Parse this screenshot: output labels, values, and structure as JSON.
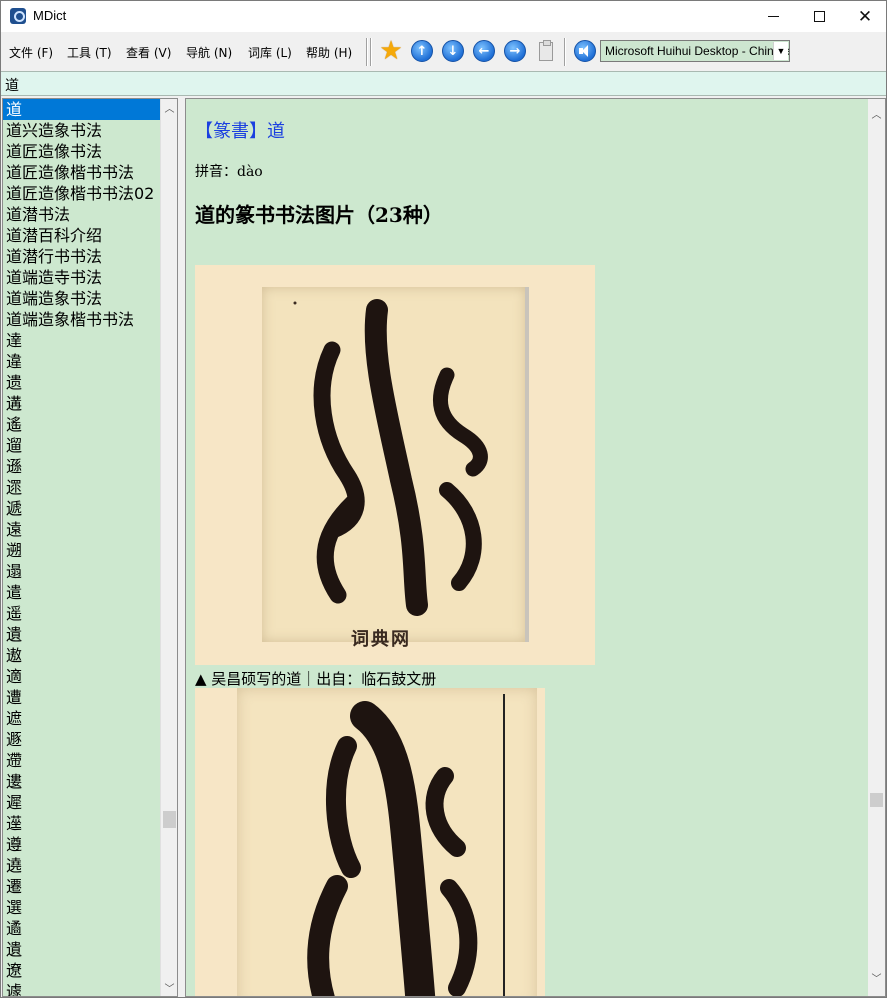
{
  "window": {
    "title": "MDict",
    "controls": [
      "minimize",
      "maximize",
      "close"
    ]
  },
  "menu": [
    {
      "label": "文件 (F)",
      "name": "menu-file"
    },
    {
      "label": "工具 (T)",
      "name": "menu-tools"
    },
    {
      "label": "查看 (V)",
      "name": "menu-view"
    },
    {
      "label": "导航 (N)",
      "name": "menu-navigate"
    },
    {
      "label": "词库 (L)",
      "name": "menu-library"
    },
    {
      "label": "帮助 (H)",
      "name": "menu-help"
    }
  ],
  "toolbar": {
    "icons": [
      "favorite-star-icon",
      "arrow-up-icon",
      "arrow-down-icon",
      "arrow-left-icon",
      "arrow-right-icon",
      "paste-icon",
      "speaker-icon"
    ],
    "dictionary_select": "Microsoft Huihui Desktop - Chinese"
  },
  "search": {
    "value": "道"
  },
  "wordlist": {
    "items": [
      "道",
      "道兴造象书法",
      "道匠造像书法",
      "道匠造像楷书书法",
      "道匠造像楷书书法02",
      "道潜书法",
      "道潜百科介绍",
      "道潜行书书法",
      "道端造寺书法",
      "道端造象书法",
      "道端造象楷书书法",
      "達",
      "違",
      "遗",
      "遘",
      "遙",
      "遛",
      "遜",
      "遝",
      "遞",
      "遠",
      "遡",
      "遢",
      "遣",
      "遥",
      "遺",
      "遨",
      "適",
      "遭",
      "遮",
      "遯",
      "遰",
      "遱",
      "遲",
      "遳",
      "遵",
      "遶",
      "遷",
      "選",
      "遹",
      "遺",
      "遼",
      "遽"
    ],
    "selected_index": 0
  },
  "content": {
    "headword": "【篆書】道",
    "pinyin": "拼音：dào",
    "heading": "道的篆书书法图片（23种）",
    "image_watermark": "词典网",
    "caption": "▲ 吴昌硕写的道｜出自：临石鼓文册"
  },
  "colors": {
    "background_green": "#cde8cf",
    "selection_blue": "#0078d7",
    "link_blue": "#1a3fe0",
    "paper": "#f7e6c6",
    "ink": "#1e1410"
  }
}
